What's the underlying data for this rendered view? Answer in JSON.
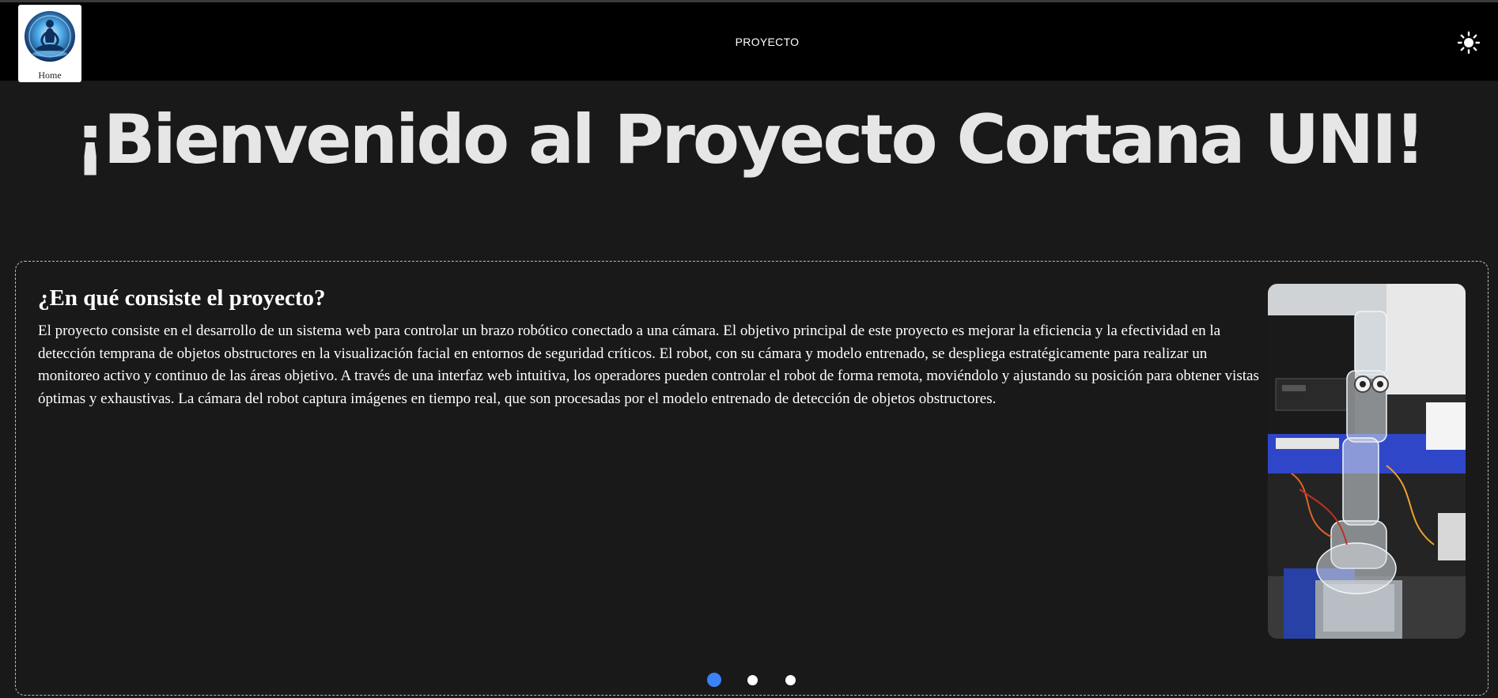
{
  "header": {
    "home_label": "Home",
    "nav_label": "PROYECTO",
    "theme_icon": "sun-icon"
  },
  "hero": {
    "title": "¡Bienvenido al Proyecto Cortana UNI!"
  },
  "slide": {
    "title": "¿En qué consiste el proyecto?",
    "body": "El proyecto consiste en el desarrollo de un sistema web para controlar un brazo robótico conectado a una cámara. El objetivo principal de este proyecto es mejorar la eficiencia y la efectividad en la detección temprana de objetos obstructores en la visualización facial en entornos de seguridad críticos. El robot, con su cámara y modelo entrenado, se despliega estratégicamente para realizar un monitoreo activo y continuo de las áreas objetivo. A través de una interfaz web intuitiva, los operadores pueden controlar el robot de forma remota, moviéndolo y ajustando su posición para obtener vistas óptimas y exhaustivas. La cámara del robot captura imágenes en tiempo real, que son procesadas por el modelo entrenado de detección de objetos obstructores."
  },
  "carousel": {
    "slide_count": 3,
    "active_index": 0
  },
  "colors": {
    "page_background": "#191919",
    "topbar": "#000000",
    "active_dot": "#3b82f6",
    "inactive_dot": "#ffffff"
  }
}
